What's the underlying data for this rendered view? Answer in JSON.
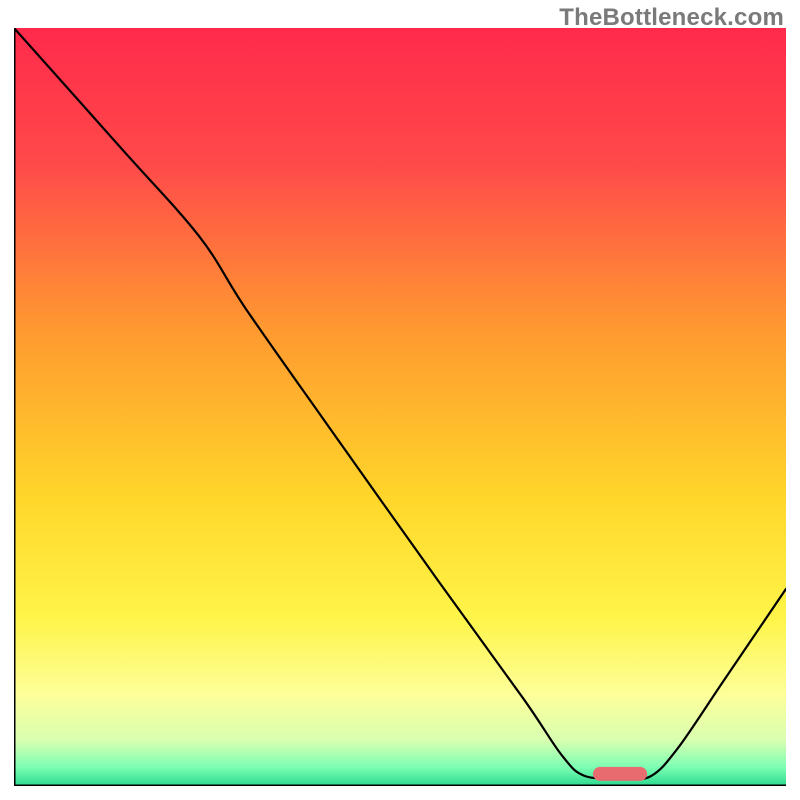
{
  "watermark": "TheBottleneck.com",
  "chart_data": {
    "type": "line",
    "title": "",
    "xlabel": "",
    "ylabel": "",
    "xlim": [
      0,
      100
    ],
    "ylim": [
      0,
      100
    ],
    "grid": false,
    "legend": false,
    "background_gradient": [
      {
        "offset": 0.0,
        "color": "#ff2a4b"
      },
      {
        "offset": 0.18,
        "color": "#ff4a4a"
      },
      {
        "offset": 0.4,
        "color": "#ff9a30"
      },
      {
        "offset": 0.62,
        "color": "#ffd62a"
      },
      {
        "offset": 0.78,
        "color": "#fff54a"
      },
      {
        "offset": 0.88,
        "color": "#fdff9a"
      },
      {
        "offset": 0.94,
        "color": "#d8ffb0"
      },
      {
        "offset": 0.975,
        "color": "#7dffb4"
      },
      {
        "offset": 1.0,
        "color": "#2bd98f"
      }
    ],
    "curve": [
      {
        "x": 0.0,
        "y": 100.0
      },
      {
        "x": 14.0,
        "y": 84.0
      },
      {
        "x": 24.0,
        "y": 72.5
      },
      {
        "x": 30.0,
        "y": 63.0
      },
      {
        "x": 40.0,
        "y": 48.5
      },
      {
        "x": 55.0,
        "y": 27.0
      },
      {
        "x": 66.0,
        "y": 11.5
      },
      {
        "x": 71.0,
        "y": 4.0
      },
      {
        "x": 74.0,
        "y": 1.3
      },
      {
        "x": 79.0,
        "y": 1.0
      },
      {
        "x": 82.5,
        "y": 1.3
      },
      {
        "x": 86.0,
        "y": 5.0
      },
      {
        "x": 92.0,
        "y": 14.0
      },
      {
        "x": 100.0,
        "y": 26.0
      }
    ],
    "optimal_marker": {
      "x_start": 75.0,
      "x_end": 82.0,
      "y": 1.6,
      "color": "#e86b6f"
    },
    "axis_color": "#000000"
  }
}
